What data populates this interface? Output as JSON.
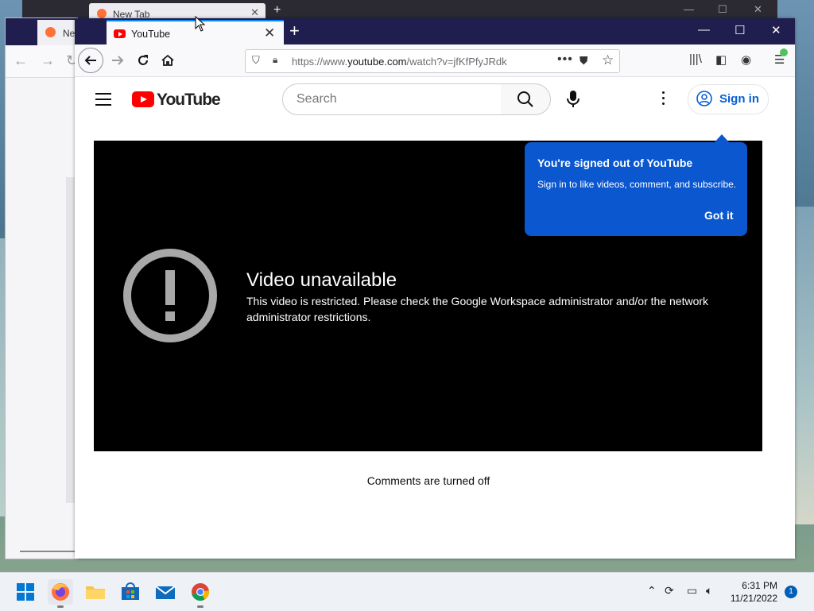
{
  "background_window": {
    "tab_label": "New Tab",
    "tab_label_short": "Ne"
  },
  "browser": {
    "tab_label": "YouTube",
    "url_prefix": "https://www.",
    "url_domain": "youtube.com",
    "url_path": "/watch?v=jfKfPfyJRdk"
  },
  "youtube": {
    "logo_text": "YouTube",
    "search_placeholder": "Search",
    "sign_in_label": "Sign in",
    "error_title": "Video unavailable",
    "error_message": "This video is restricted. Please check the Google Workspace administrator and/or the network administrator restrictions.",
    "comments_status": "Comments are turned off",
    "tooltip": {
      "title": "You're signed out of YouTube",
      "body": "Sign in to like videos, comment, and subscribe.",
      "button": "Got it"
    }
  },
  "taskbar": {
    "apps": [
      "start-icon",
      "firefox-icon",
      "file-explorer-icon",
      "microsoft-store-icon",
      "mail-icon",
      "chrome-icon"
    ],
    "time": "6:31 PM",
    "date": "11/21/2022",
    "notification_count": "1"
  },
  "colors": {
    "firefox_titlebar": "#1f1e4e",
    "youtube_red": "#ff0000",
    "tooltip_blue": "#0b57d0",
    "sign_in_blue": "#065fd4"
  }
}
